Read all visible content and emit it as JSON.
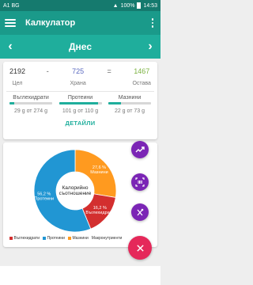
{
  "status": {
    "carrier": "A1 BG",
    "battery": "100%",
    "time": "14:53"
  },
  "appbar": {
    "title": "Калкулатор"
  },
  "daybar": {
    "prev": "‹",
    "day": "Днес",
    "next": "›"
  },
  "summary": {
    "goal": {
      "value": "2192",
      "label": "Цел",
      "color": "#333333"
    },
    "minus": "-",
    "food": {
      "value": "725",
      "label": "Храна",
      "color": "#5c6bc0"
    },
    "equals": "=",
    "remaining": {
      "value": "1467",
      "label": "Остава",
      "color": "#7cb342"
    }
  },
  "macros": [
    {
      "name": "Въглехидрати",
      "text": "29 g от 274 g",
      "progress": 0.106,
      "color": "#1fae9c"
    },
    {
      "name": "Протеини",
      "text": "101 g от 110 g",
      "progress": 0.918,
      "color": "#1fae9c"
    },
    {
      "name": "Мазнини",
      "text": "22 g от 73 g",
      "progress": 0.301,
      "color": "#1fae9c"
    }
  ],
  "details_label": "ДЕТАЙЛИ",
  "chart_data": {
    "type": "pie",
    "center_label": [
      "Калорийно",
      "съотношение"
    ],
    "slices": [
      {
        "name": "Въглехидрати",
        "value": 16.2,
        "label": [
          "16,2 %",
          "Въглехидрати"
        ],
        "color": "#d32f2f"
      },
      {
        "name": "Протеини",
        "value": 56.2,
        "label": [
          "56,2 %",
          "Протеини"
        ],
        "color": "#2196d3"
      },
      {
        "name": "Мазнини",
        "value": 27.6,
        "label": [
          "27,6 %",
          "Мазнини"
        ],
        "color": "#ff9a1f"
      }
    ],
    "legend": [
      {
        "name": "Въглехидрати",
        "color": "#d32f2f"
      },
      {
        "name": "Протеини",
        "color": "#2196d3"
      },
      {
        "name": "Мазнини",
        "color": "#ff9a1f"
      },
      {
        "name": "Макронутриенти",
        "color": ""
      }
    ]
  },
  "fabs": {
    "trend_icon": "trend-line-icon",
    "scan_icon": "barcode-scan-icon",
    "food_icon": "cutlery-icon",
    "close_icon": "close-icon"
  },
  "colors": {
    "primary_dark": "#157a6e",
    "primary": "#1a9a8a",
    "accent": "#1fae9c",
    "fab_purple": "#7b25b5",
    "fab_pink": "#e5285a"
  }
}
